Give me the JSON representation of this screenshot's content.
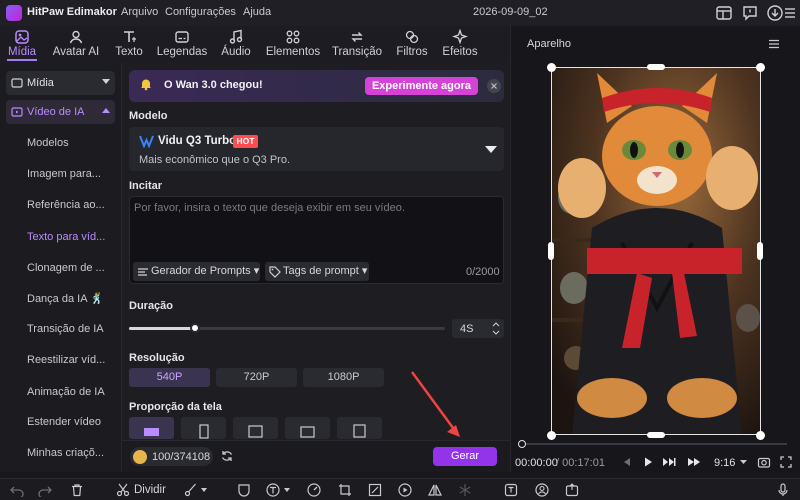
{
  "titlebar": {
    "app_title": "HitPaw Edimakor",
    "menus": [
      "Arquivo",
      "Configurações",
      "Ajuda"
    ],
    "project_name": "2026-09-09_02"
  },
  "tabs": [
    {
      "label": "Mídia",
      "icon": "media-icon",
      "active": true
    },
    {
      "label": "Avatar AI",
      "icon": "avatar-icon"
    },
    {
      "label": "Texto",
      "icon": "text-icon"
    },
    {
      "label": "Legendas",
      "icon": "captions-icon"
    },
    {
      "label": "Áudio",
      "icon": "music-icon"
    },
    {
      "label": "Elementos",
      "icon": "elements-icon"
    },
    {
      "label": "Transição",
      "icon": "transition-icon"
    },
    {
      "label": "Filtros",
      "icon": "filter-icon"
    },
    {
      "label": "Efeitos",
      "icon": "sparkle-icon"
    }
  ],
  "sidebar": {
    "media_header": "Mídia",
    "ai_video_header": "Vídeo de IA",
    "items": [
      {
        "label": "Modelos"
      },
      {
        "label": "Imagem para..."
      },
      {
        "label": "Referência ao..."
      },
      {
        "label": "Texto para víd...",
        "active": true
      },
      {
        "label": "Clonagem de ..."
      },
      {
        "label": "Dança da IA 🕺"
      },
      {
        "label": "Transição de IA"
      },
      {
        "label": "Reestilizar víd..."
      },
      {
        "label": "Animação de IA"
      },
      {
        "label": "Estender vídeo"
      },
      {
        "label": "Minhas criaçõ..."
      }
    ]
  },
  "banner": {
    "text": "O Wan 3.0 chegou!",
    "button": "Experimente agora"
  },
  "model": {
    "section_label": "Modelo",
    "name": "Vidu Q3 Turbo",
    "badge": "HOT",
    "description": "Mais econômico que o Q3 Pro."
  },
  "prompt": {
    "section_label": "Incitar",
    "placeholder": "Por favor, insira o texto que deseja exibir em seu vídeo.",
    "generator_button": "Gerador de Prompts",
    "tags_button": "Tags de prompt",
    "char_count": "0/2000"
  },
  "duration": {
    "label": "Duração",
    "value": "4S",
    "slider_fraction": 0.21
  },
  "resolution": {
    "label": "Resolução",
    "options": [
      "540P",
      "720P",
      "1080P"
    ],
    "selected": "540P"
  },
  "aspect": {
    "label": "Proporção da tela"
  },
  "footer": {
    "credits": "100/374108",
    "generate": "Gerar"
  },
  "preview": {
    "title": "Aparelho",
    "time_current": "00:00:00",
    "time_total": "/ 00:17:01",
    "aspect_ratio": "9:16"
  },
  "bottombar": {
    "split_label": "Dividir"
  },
  "colors": {
    "accent": "#a77bf6",
    "generate": "#9333ea",
    "try_button": "#d542d6",
    "hot": "#ff4d4f"
  }
}
